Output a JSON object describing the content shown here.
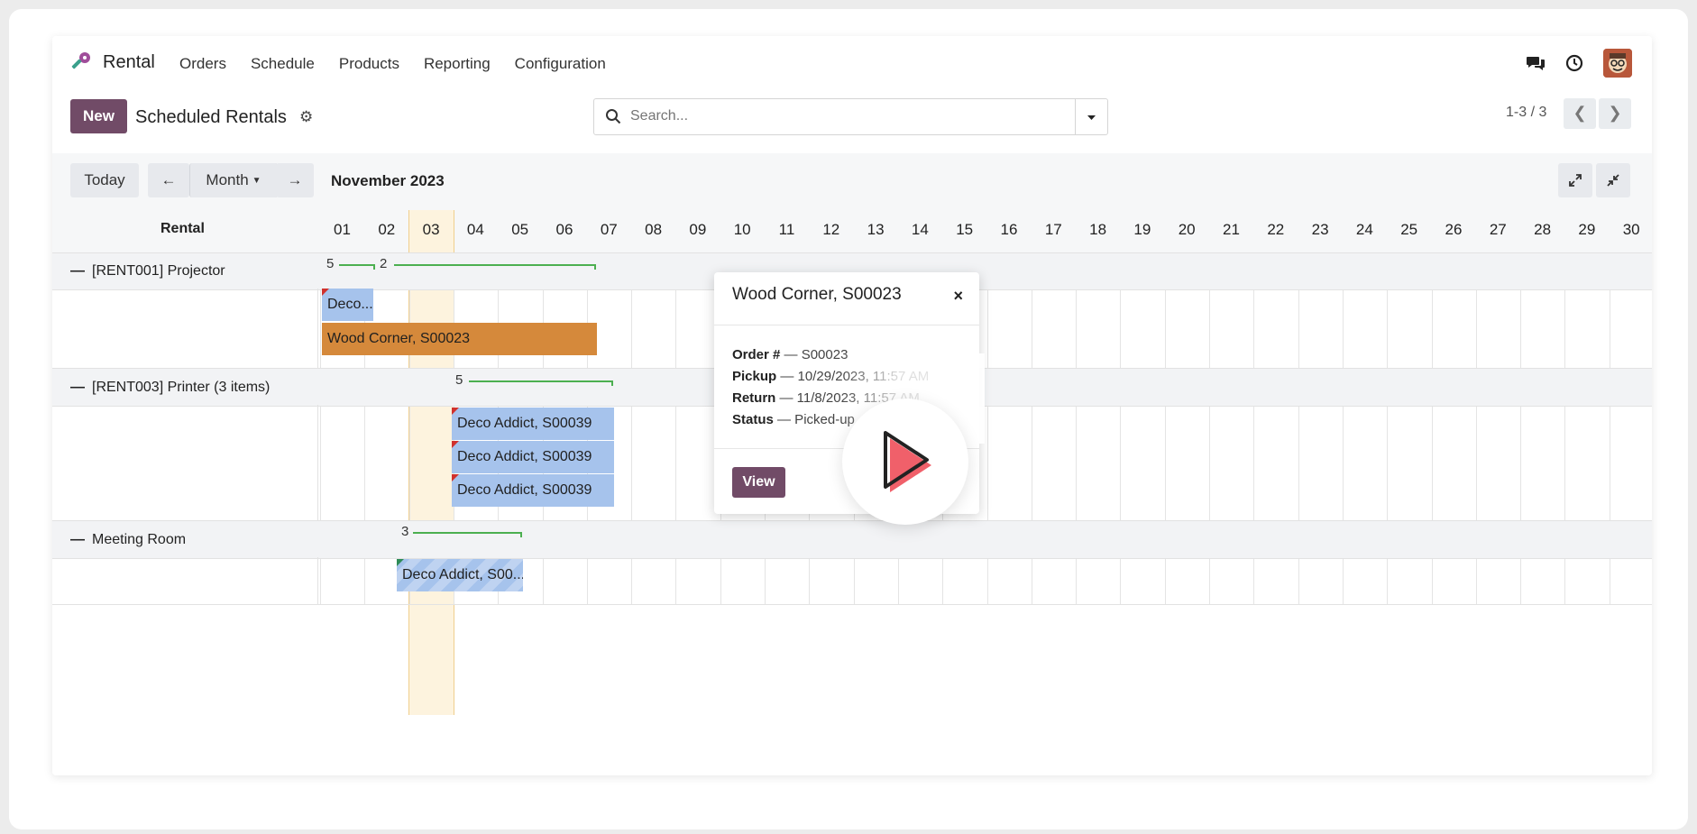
{
  "navbar": {
    "brand": "Rental",
    "menu": [
      "Orders",
      "Schedule",
      "Products",
      "Reporting",
      "Configuration"
    ]
  },
  "control_panel": {
    "new_label": "New",
    "title": "Scheduled Rentals",
    "search_placeholder": "Search...",
    "pager": "1-3 / 3"
  },
  "gantt": {
    "today_label": "Today",
    "scale_label": "Month",
    "period": "November 2023",
    "row_header": "Rental",
    "days": [
      "01",
      "02",
      "03",
      "04",
      "05",
      "06",
      "07",
      "08",
      "09",
      "10",
      "11",
      "12",
      "13",
      "14",
      "15",
      "16",
      "17",
      "18",
      "19",
      "20",
      "21",
      "22",
      "23",
      "24",
      "25",
      "26",
      "27",
      "28",
      "29",
      "30"
    ],
    "groups": [
      {
        "label": "[RENT001] Projector",
        "counters": [
          "5",
          "2"
        ],
        "pills": [
          "Deco...",
          "Wood Corner, S00023"
        ]
      },
      {
        "label": "[RENT003] Printer (3 items)",
        "counters": [
          "5"
        ],
        "pills": [
          "Deco Addict, S00039",
          "Deco Addict, S00039",
          "Deco Addict, S00039"
        ]
      },
      {
        "label": "Meeting Room",
        "counters": [
          "3"
        ],
        "pills": [
          "Deco Addict, S00..."
        ]
      }
    ]
  },
  "popover": {
    "title": "Wood Corner, S00023",
    "close": "×",
    "order_label": "Order #",
    "order_value": "— S00023",
    "pickup_label": "Pickup",
    "pickup_value": "— 10/29/2023, 11:57 AM",
    "return_label": "Return",
    "return_value": "— 11/8/2023, 11:57 AM",
    "status_label": "Status",
    "status_value": "— Picked-up",
    "view_label": "View"
  },
  "colors": {
    "primary": "#714b67",
    "pill_blue": "#a6c3ec",
    "pill_orange": "#d5893b",
    "counter_green": "#4caf50",
    "today_column": "#fdf3de",
    "play_red": "#f0606a"
  }
}
